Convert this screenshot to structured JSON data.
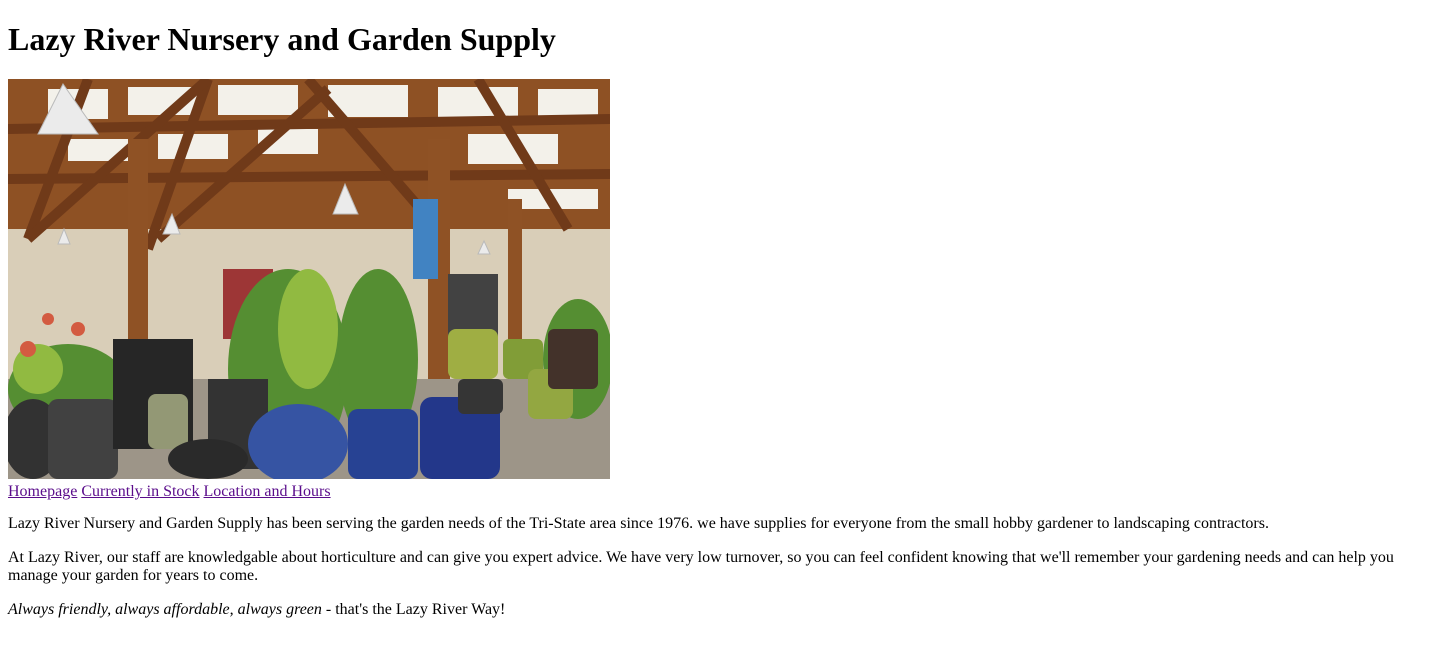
{
  "page": {
    "title": "Lazy River Nursery and Garden Supply"
  },
  "nav": {
    "links": [
      {
        "label": "Homepage"
      },
      {
        "label": "Currently in Stock"
      },
      {
        "label": "Location and Hours"
      }
    ],
    "link_color": "#5a0c8b"
  },
  "content": {
    "intro": "Lazy River Nursery and Garden Supply has been serving the garden needs of the Tri-State area since 1976. we have supplies for everyone from the small hobby gardener to landscaping contractors.",
    "staff": "At Lazy River, our staff are knowledgable about horticulture and can give you expert advice. We have very low turnover, so you can feel confident knowing that we'll remember your gardening needs and can help you manage your garden for years to come.",
    "slogan_italic": "Always friendly, always affordable, always green",
    "slogan_rest": " - that's the Lazy River Way!"
  },
  "hero_image": {
    "icon": "garden-center-photo"
  }
}
